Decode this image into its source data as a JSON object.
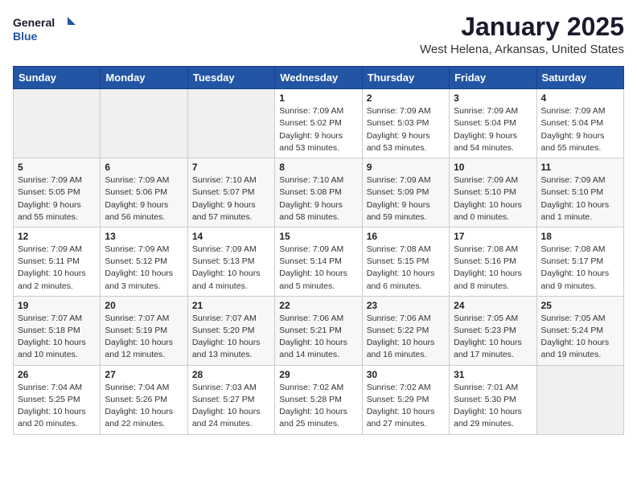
{
  "header": {
    "logo_general": "General",
    "logo_blue": "Blue",
    "month_title": "January 2025",
    "subtitle": "West Helena, Arkansas, United States"
  },
  "days_of_week": [
    "Sunday",
    "Monday",
    "Tuesday",
    "Wednesday",
    "Thursday",
    "Friday",
    "Saturday"
  ],
  "weeks": [
    [
      {
        "day": "",
        "info": ""
      },
      {
        "day": "",
        "info": ""
      },
      {
        "day": "",
        "info": ""
      },
      {
        "day": "1",
        "info": "Sunrise: 7:09 AM\nSunset: 5:02 PM\nDaylight: 9 hours and 53 minutes."
      },
      {
        "day": "2",
        "info": "Sunrise: 7:09 AM\nSunset: 5:03 PM\nDaylight: 9 hours and 53 minutes."
      },
      {
        "day": "3",
        "info": "Sunrise: 7:09 AM\nSunset: 5:04 PM\nDaylight: 9 hours and 54 minutes."
      },
      {
        "day": "4",
        "info": "Sunrise: 7:09 AM\nSunset: 5:04 PM\nDaylight: 9 hours and 55 minutes."
      }
    ],
    [
      {
        "day": "5",
        "info": "Sunrise: 7:09 AM\nSunset: 5:05 PM\nDaylight: 9 hours and 55 minutes."
      },
      {
        "day": "6",
        "info": "Sunrise: 7:09 AM\nSunset: 5:06 PM\nDaylight: 9 hours and 56 minutes."
      },
      {
        "day": "7",
        "info": "Sunrise: 7:10 AM\nSunset: 5:07 PM\nDaylight: 9 hours and 57 minutes."
      },
      {
        "day": "8",
        "info": "Sunrise: 7:10 AM\nSunset: 5:08 PM\nDaylight: 9 hours and 58 minutes."
      },
      {
        "day": "9",
        "info": "Sunrise: 7:09 AM\nSunset: 5:09 PM\nDaylight: 9 hours and 59 minutes."
      },
      {
        "day": "10",
        "info": "Sunrise: 7:09 AM\nSunset: 5:10 PM\nDaylight: 10 hours and 0 minutes."
      },
      {
        "day": "11",
        "info": "Sunrise: 7:09 AM\nSunset: 5:10 PM\nDaylight: 10 hours and 1 minute."
      }
    ],
    [
      {
        "day": "12",
        "info": "Sunrise: 7:09 AM\nSunset: 5:11 PM\nDaylight: 10 hours and 2 minutes."
      },
      {
        "day": "13",
        "info": "Sunrise: 7:09 AM\nSunset: 5:12 PM\nDaylight: 10 hours and 3 minutes."
      },
      {
        "day": "14",
        "info": "Sunrise: 7:09 AM\nSunset: 5:13 PM\nDaylight: 10 hours and 4 minutes."
      },
      {
        "day": "15",
        "info": "Sunrise: 7:09 AM\nSunset: 5:14 PM\nDaylight: 10 hours and 5 minutes."
      },
      {
        "day": "16",
        "info": "Sunrise: 7:08 AM\nSunset: 5:15 PM\nDaylight: 10 hours and 6 minutes."
      },
      {
        "day": "17",
        "info": "Sunrise: 7:08 AM\nSunset: 5:16 PM\nDaylight: 10 hours and 8 minutes."
      },
      {
        "day": "18",
        "info": "Sunrise: 7:08 AM\nSunset: 5:17 PM\nDaylight: 10 hours and 9 minutes."
      }
    ],
    [
      {
        "day": "19",
        "info": "Sunrise: 7:07 AM\nSunset: 5:18 PM\nDaylight: 10 hours and 10 minutes."
      },
      {
        "day": "20",
        "info": "Sunrise: 7:07 AM\nSunset: 5:19 PM\nDaylight: 10 hours and 12 minutes."
      },
      {
        "day": "21",
        "info": "Sunrise: 7:07 AM\nSunset: 5:20 PM\nDaylight: 10 hours and 13 minutes."
      },
      {
        "day": "22",
        "info": "Sunrise: 7:06 AM\nSunset: 5:21 PM\nDaylight: 10 hours and 14 minutes."
      },
      {
        "day": "23",
        "info": "Sunrise: 7:06 AM\nSunset: 5:22 PM\nDaylight: 10 hours and 16 minutes."
      },
      {
        "day": "24",
        "info": "Sunrise: 7:05 AM\nSunset: 5:23 PM\nDaylight: 10 hours and 17 minutes."
      },
      {
        "day": "25",
        "info": "Sunrise: 7:05 AM\nSunset: 5:24 PM\nDaylight: 10 hours and 19 minutes."
      }
    ],
    [
      {
        "day": "26",
        "info": "Sunrise: 7:04 AM\nSunset: 5:25 PM\nDaylight: 10 hours and 20 minutes."
      },
      {
        "day": "27",
        "info": "Sunrise: 7:04 AM\nSunset: 5:26 PM\nDaylight: 10 hours and 22 minutes."
      },
      {
        "day": "28",
        "info": "Sunrise: 7:03 AM\nSunset: 5:27 PM\nDaylight: 10 hours and 24 minutes."
      },
      {
        "day": "29",
        "info": "Sunrise: 7:02 AM\nSunset: 5:28 PM\nDaylight: 10 hours and 25 minutes."
      },
      {
        "day": "30",
        "info": "Sunrise: 7:02 AM\nSunset: 5:29 PM\nDaylight: 10 hours and 27 minutes."
      },
      {
        "day": "31",
        "info": "Sunrise: 7:01 AM\nSunset: 5:30 PM\nDaylight: 10 hours and 29 minutes."
      },
      {
        "day": "",
        "info": ""
      }
    ]
  ]
}
